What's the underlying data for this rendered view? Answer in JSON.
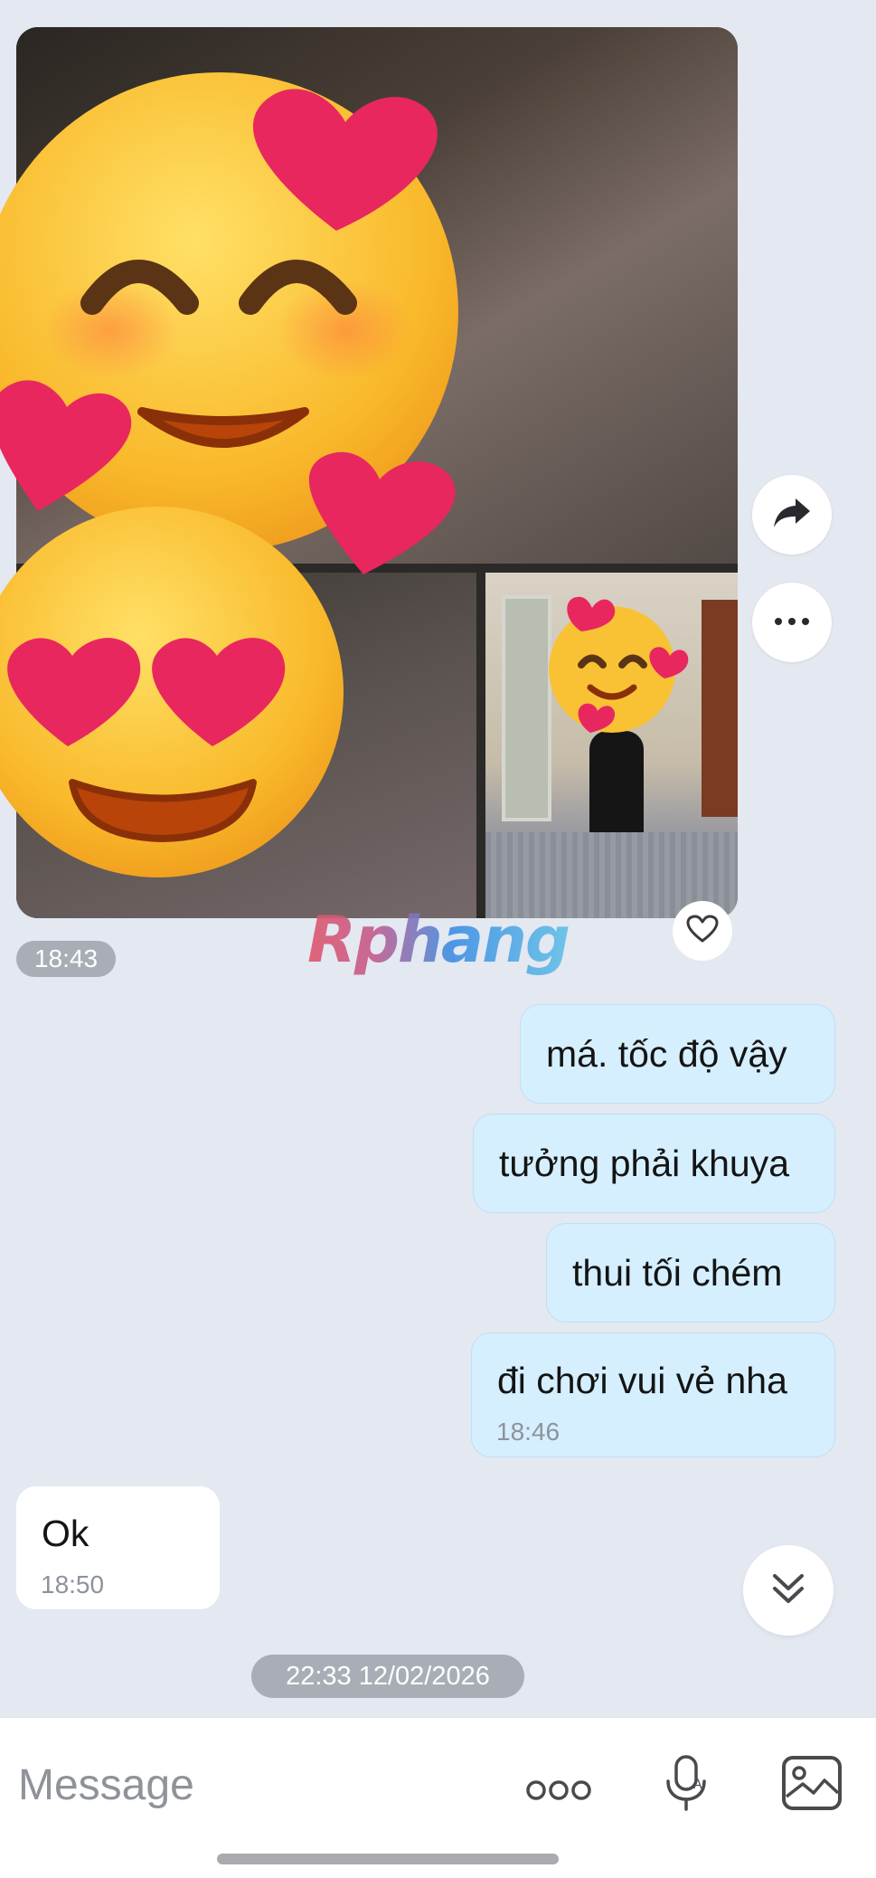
{
  "chat": {
    "album_time": "18:43",
    "watermark": "Rphang",
    "messages_out": [
      {
        "text": "má. tốc độ vậy"
      },
      {
        "text": "tưởng phải khuya"
      },
      {
        "text": "thui tối chém"
      },
      {
        "text": "đi chơi vui vẻ nha",
        "time": "18:46"
      }
    ],
    "message_in": {
      "text": "Ok",
      "time": "18:50"
    },
    "date_separator": "22:33 12/02/2026"
  },
  "input": {
    "placeholder": "Message"
  },
  "icons": {
    "forward": "forward-arrow-icon",
    "more": "more-dots-icon",
    "like": "heart-outline-icon",
    "scroll_down": "double-chevron-down-icon",
    "options": "three-circles-icon",
    "voice": "microphone-icon",
    "gallery": "image-gallery-icon"
  },
  "colors": {
    "background": "#e3e8f1",
    "outgoing_bubble": "#d5efff",
    "incoming_bubble": "#ffffff",
    "time_pill": "#a9aeb6"
  }
}
